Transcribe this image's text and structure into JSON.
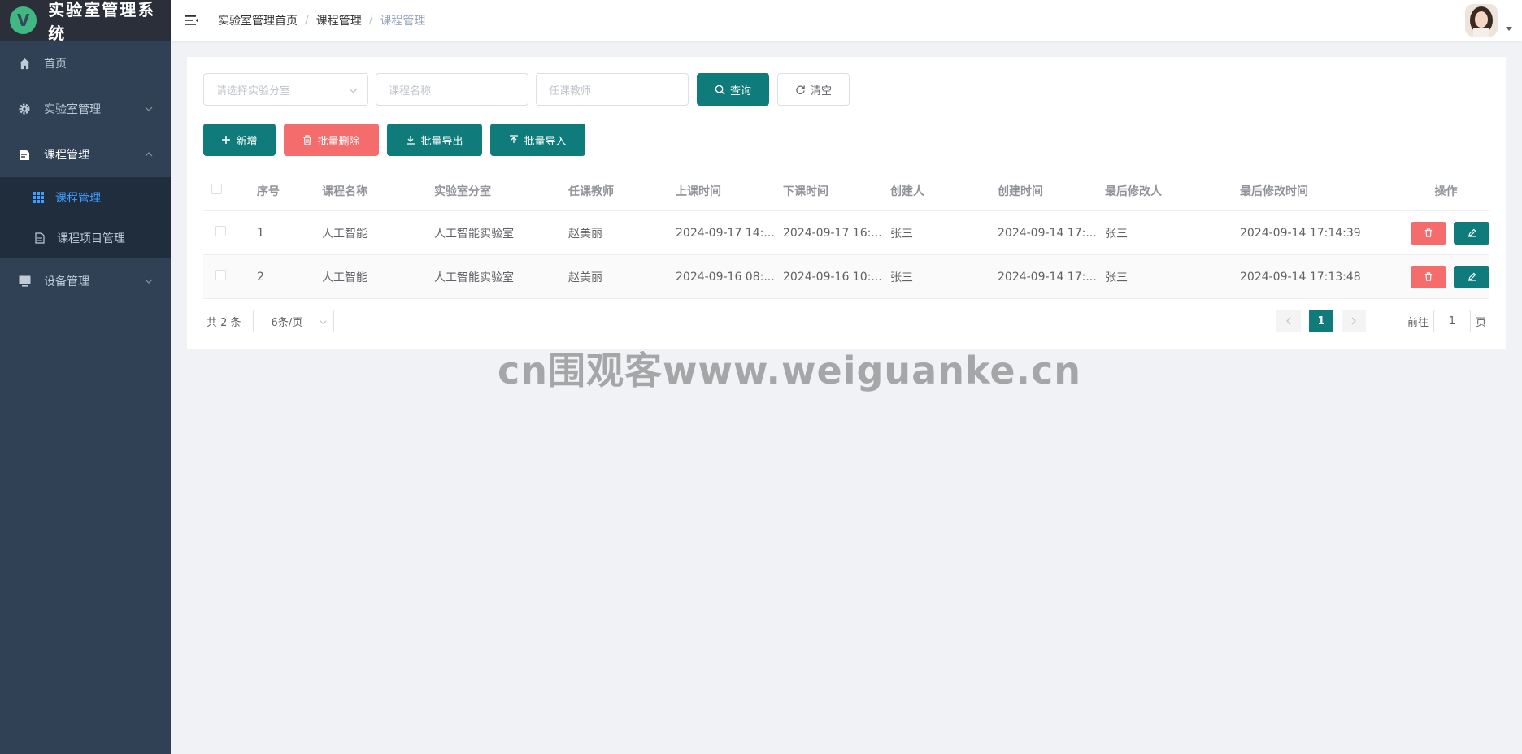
{
  "app": {
    "logo_letter": "V",
    "title": "实验室管理系统"
  },
  "sidebar": {
    "items": [
      {
        "label": "首页",
        "icon": "home-icon"
      },
      {
        "label": "实验室管理",
        "icon": "gear-icon"
      },
      {
        "label": "课程管理",
        "icon": "document-icon",
        "open": true,
        "children": [
          {
            "label": "课程管理",
            "icon": "grid-icon",
            "active": true
          },
          {
            "label": "课程项目管理",
            "icon": "file-icon"
          }
        ]
      },
      {
        "label": "设备管理",
        "icon": "monitor-icon"
      }
    ]
  },
  "header": {
    "breadcrumb": [
      "实验室管理首页",
      "课程管理",
      "课程管理"
    ]
  },
  "filters": {
    "lab_placeholder": "请选择实验分室",
    "course_placeholder": "课程名称",
    "teacher_placeholder": "任课教师",
    "search_label": "查询",
    "clear_label": "清空"
  },
  "actions": {
    "add_label": "新增",
    "batch_delete_label": "批量删除",
    "batch_export_label": "批量导出",
    "batch_import_label": "批量导入"
  },
  "table": {
    "columns": [
      "序号",
      "课程名称",
      "实验室分室",
      "任课教师",
      "上课时间",
      "下课时间",
      "创建人",
      "创建时间",
      "最后修改人",
      "最后修改时间",
      "操作"
    ],
    "rows": [
      [
        "1",
        "人工智能",
        "人工智能实验室",
        "赵美丽",
        "2024-09-17 14:...",
        "2024-09-17 16:...",
        "张三",
        "2024-09-14 17:...",
        "张三",
        "2024-09-14 17:14:39"
      ],
      [
        "2",
        "人工智能",
        "人工智能实验室",
        "赵美丽",
        "2024-09-16 08:...",
        "2024-09-16 10:...",
        "张三",
        "2024-09-14 17:...",
        "张三",
        "2024-09-14 17:13:48"
      ]
    ]
  },
  "pagination": {
    "total_text": "共 2 条",
    "page_size": "6条/页",
    "current_page": "1",
    "goto_prefix": "前往",
    "goto_value": "1",
    "goto_suffix": "页"
  },
  "watermark": "cn围观客www.weiguanke.cn",
  "colors": {
    "sidebar_bg": "#304156",
    "primary": "#0f7b7b",
    "danger": "#f56c6c",
    "active_menu": "#409eff"
  }
}
